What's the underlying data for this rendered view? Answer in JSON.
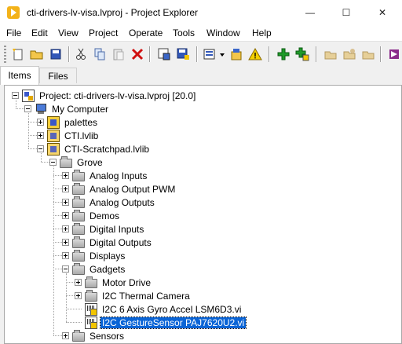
{
  "window": {
    "title": "cti-drivers-lv-visa.lvproj - Project Explorer",
    "minimize_glyph": "—",
    "maximize_glyph": "☐",
    "close_glyph": "✕"
  },
  "menu": [
    "File",
    "Edit",
    "View",
    "Project",
    "Operate",
    "Tools",
    "Window",
    "Help"
  ],
  "toolbar": {
    "icons": [
      "new-icon",
      "open-icon",
      "save-all-icon",
      "cut-icon",
      "copy-icon",
      "paste-icon",
      "delete-icon",
      "build-icon",
      "save-icon",
      "view-icon",
      "dropdown-icon",
      "resolve-icon",
      "warning-icon",
      "add-icon",
      "add-item-icon",
      "folder-action-icon",
      "folder-action2-icon",
      "folder-action3-icon"
    ]
  },
  "tabs": [
    {
      "label": "Items",
      "active": true
    },
    {
      "label": "Files",
      "active": false
    }
  ],
  "tree": [
    {
      "label": "Project: cti-drivers-lv-visa.lvproj [20.0]",
      "icon": "project",
      "depth": 0,
      "expander": "minus"
    },
    {
      "label": "My Computer",
      "icon": "computer",
      "depth": 1,
      "expander": "minus"
    },
    {
      "label": "palettes",
      "icon": "palette",
      "depth": 2,
      "expander": "plus"
    },
    {
      "label": "CTI.lvlib",
      "icon": "lvlib",
      "depth": 2,
      "expander": "plus"
    },
    {
      "label": "CTI-Scratchpad.lvlib",
      "icon": "lvlib",
      "depth": 2,
      "expander": "minus"
    },
    {
      "label": "Grove",
      "icon": "folder",
      "depth": 3,
      "expander": "minus"
    },
    {
      "label": "Analog Inputs",
      "icon": "folder",
      "depth": 4,
      "expander": "plus"
    },
    {
      "label": "Analog Output PWM",
      "icon": "folder",
      "depth": 4,
      "expander": "plus"
    },
    {
      "label": "Analog Outputs",
      "icon": "folder",
      "depth": 4,
      "expander": "plus"
    },
    {
      "label": "Demos",
      "icon": "folder",
      "depth": 4,
      "expander": "plus"
    },
    {
      "label": "Digital Inputs",
      "icon": "folder",
      "depth": 4,
      "expander": "plus"
    },
    {
      "label": "Digital Outputs",
      "icon": "folder",
      "depth": 4,
      "expander": "plus"
    },
    {
      "label": "Displays",
      "icon": "folder",
      "depth": 4,
      "expander": "plus"
    },
    {
      "label": "Gadgets",
      "icon": "folder",
      "depth": 4,
      "expander": "minus"
    },
    {
      "label": "Motor Drive",
      "icon": "folder",
      "depth": 5,
      "expander": "plus"
    },
    {
      "label": "I2C Thermal Camera",
      "icon": "folder",
      "depth": 5,
      "expander": "plus"
    },
    {
      "label": "I2C 6 Axis Gyro Accel LSM6D3.vi",
      "icon": "vi",
      "depth": 5,
      "expander": ""
    },
    {
      "label": "I2C GestureSensor PAJ7620U2.vi",
      "icon": "vi",
      "depth": 5,
      "expander": "",
      "selected": true
    },
    {
      "label": "Sensors",
      "icon": "folder",
      "depth": 4,
      "expander": "plus"
    }
  ]
}
